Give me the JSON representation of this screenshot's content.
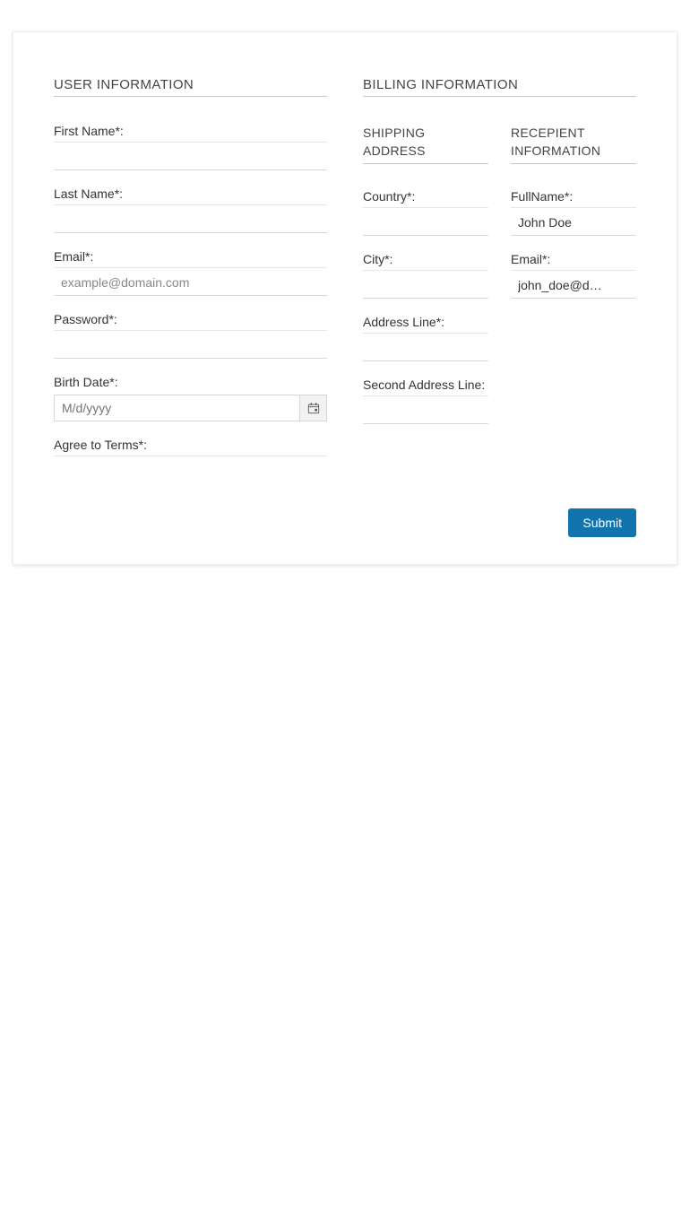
{
  "user_info": {
    "title": "USER INFORMATION",
    "first_name_label": "First Name*:",
    "first_name_value": "",
    "last_name_label": "Last Name*:",
    "last_name_value": "",
    "email_label": "Email*:",
    "email_placeholder": "example@domain.com",
    "email_value": "",
    "password_label": "Password*:",
    "password_value": "",
    "birth_date_label": "Birth Date*:",
    "birth_date_placeholder": "M/d/yyyy",
    "birth_date_value": "",
    "agree_label": "Agree to Terms*:"
  },
  "billing_info": {
    "title": "BILLING INFORMATION",
    "shipping": {
      "title": "SHIPPING ADDRESS",
      "country_label": "Country*:",
      "country_value": "",
      "city_label": "City*:",
      "city_value": "",
      "address_label": "Address Line*:",
      "address_value": "",
      "address2_label": "Second Address Line:",
      "address2_value": ""
    },
    "recipient": {
      "title": "RECEPIENT INFORMATION",
      "fullname_label": "FullName*:",
      "fullname_value": "John Doe",
      "email_label": "Email*:",
      "email_value": "john_doe@d…"
    }
  },
  "buttons": {
    "submit": "Submit"
  },
  "icons": {
    "calendar": "calendar-icon"
  }
}
